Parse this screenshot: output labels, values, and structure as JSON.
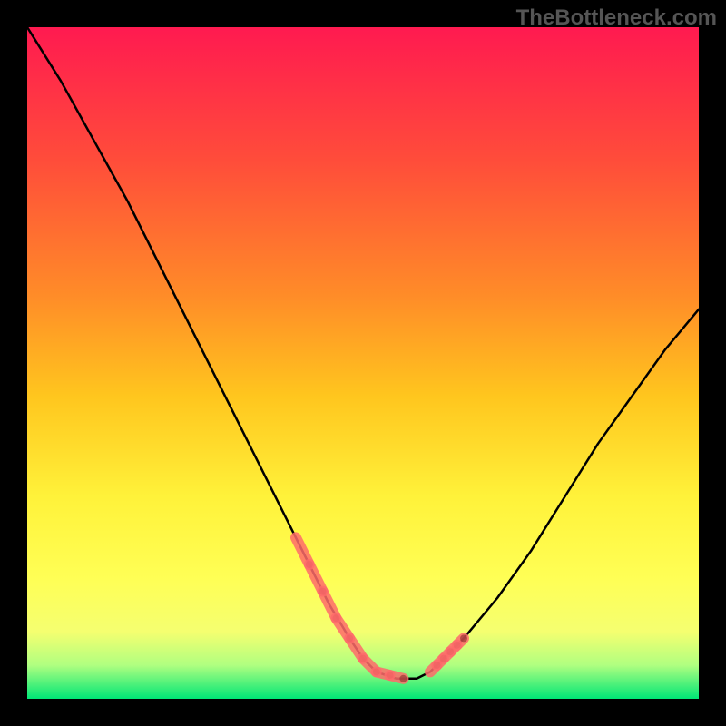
{
  "watermark": "TheBottleneck.com",
  "chart_data": {
    "type": "line",
    "title": "",
    "xlabel": "",
    "ylabel": "",
    "xlim": [
      0,
      100
    ],
    "ylim": [
      0,
      100
    ],
    "background_gradient": {
      "top": "#ff1744",
      "mid1": "#ff9800",
      "mid2": "#ffeb3b",
      "mid3": "#ffff66",
      "bottom": "#00e676"
    },
    "series": [
      {
        "name": "curve",
        "color": "#000000",
        "x": [
          0,
          5,
          10,
          15,
          20,
          25,
          30,
          35,
          40,
          45,
          48,
          50,
          52,
          55,
          58,
          60,
          62,
          65,
          70,
          75,
          80,
          85,
          90,
          95,
          100
        ],
        "y": [
          100,
          92,
          83,
          74,
          64,
          54,
          44,
          34,
          24,
          14,
          9,
          6,
          4,
          3,
          3,
          4,
          6,
          9,
          15,
          22,
          30,
          38,
          45,
          52,
          58
        ]
      },
      {
        "name": "highlight-left",
        "color": "#ff6b6b",
        "style": "dashed-thick",
        "x": [
          40,
          42,
          44,
          46,
          48,
          50,
          52,
          54,
          56
        ],
        "y": [
          24,
          20,
          16,
          12,
          9,
          6,
          4,
          3.5,
          3
        ]
      },
      {
        "name": "highlight-right",
        "color": "#ff6b6b",
        "style": "dashed-thick",
        "x": [
          60,
          61,
          62,
          63,
          64,
          65
        ],
        "y": [
          4,
          5,
          6,
          7,
          8,
          9
        ]
      }
    ]
  }
}
